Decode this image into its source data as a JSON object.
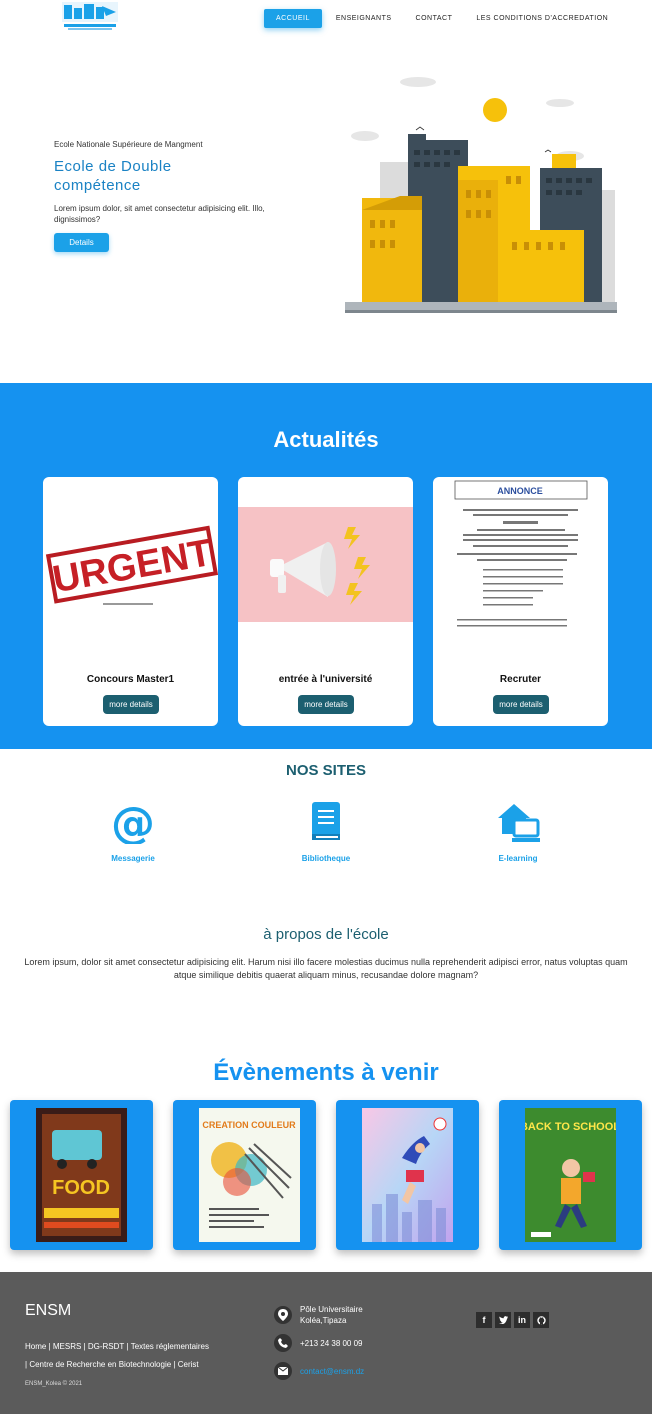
{
  "header": {
    "nav": [
      "ACCUEIL",
      "ENSEIGNANTS",
      "CONTACT",
      "LES CONDITIONS D'ACCREDATION"
    ]
  },
  "hero": {
    "subtitle": "Ecole Nationale Supérieure de Mangment",
    "title": "Ecole de Double compétence",
    "text": "Lorem ipsum dolor, sit amet consectetur adipisicing elit. Illo, dignissimos?",
    "button": "Details"
  },
  "actualites": {
    "title": "Actualités",
    "cards": [
      {
        "title": "Concours Master1",
        "button": "more details",
        "badge": "URGENT"
      },
      {
        "title": "entrée à l'université",
        "button": "more details"
      },
      {
        "title": "Recruter",
        "button": "more details",
        "badge": "ANNONCE"
      }
    ]
  },
  "sites": {
    "title": "NOS SITES",
    "items": [
      {
        "label": "Messagerie",
        "icon": "at-sign-icon"
      },
      {
        "label": "Bibliotheque",
        "icon": "book-icon"
      },
      {
        "label": "E-learning",
        "icon": "home-computer-icon"
      }
    ]
  },
  "about": {
    "title": "à propos de l'école",
    "text": "Lorem ipsum, dolor sit amet consectetur adipisicing elit. Harum nisi illo facere molestias ducimus nulla reprehenderit adipisci error, natus voluptas quam atque similique debitis quaerat aliquam minus, recusandae dolore magnam?"
  },
  "events": {
    "title": "Évènements à venir",
    "posters": [
      {
        "name": "food-truck-poster",
        "text": "FOOD"
      },
      {
        "name": "creation-couleur-poster",
        "text": "CREATION COULEUR"
      },
      {
        "name": "sport-poster",
        "text": ""
      },
      {
        "name": "back-to-school-poster",
        "text": "BACK TO SCHOOL"
      }
    ]
  },
  "footer": {
    "brand": "ENSM",
    "links": [
      "Home",
      "MESRS",
      "DG-RSDT",
      "Textes réglementaires",
      "Centre de Recherche en Biotechnologie",
      "Cerist"
    ],
    "copyright": "ENSM_Kolea © 2021",
    "address": "Pôle Universitaire Koléa,Tipaza",
    "phone": "+213 24 38 00 09",
    "email": "contact@ensm.dz"
  },
  "colors": {
    "primary": "#1592f0",
    "dark_teal": "#1c5f70",
    "footer": "#5b5b5b"
  }
}
